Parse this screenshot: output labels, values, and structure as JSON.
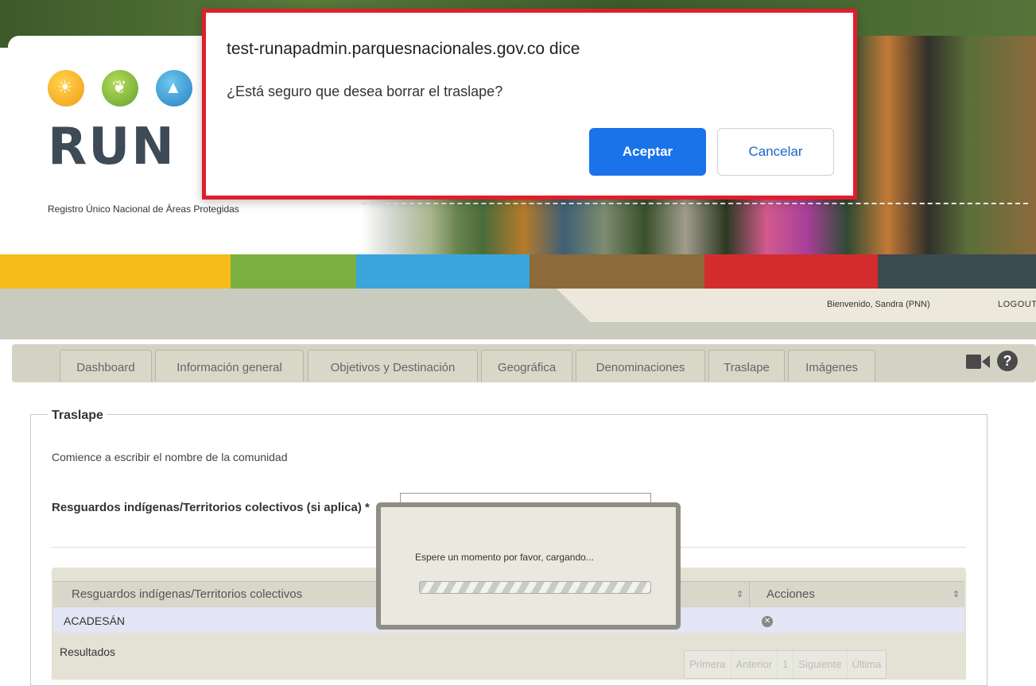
{
  "header": {
    "logo_text": "RUN",
    "subtitle": "Registro Único Nacional de Áreas Protegidas",
    "color_bands": [
      "#f6bd1a",
      "#7ab03f",
      "#3aa6db",
      "#8c6a3c",
      "#d42c2c",
      "#3c4a52"
    ]
  },
  "userbar": {
    "welcome": "Bienvenido, Sandra (PNN)",
    "logout": "LOGOUT"
  },
  "tabs": [
    {
      "label": "Dashboard"
    },
    {
      "label": "Información general"
    },
    {
      "label": "Objetivos y Destinación"
    },
    {
      "label": "Geográfica"
    },
    {
      "label": "Denominaciones"
    },
    {
      "label": "Traslape"
    },
    {
      "label": "Imágenes"
    }
  ],
  "toolbar_icons": [
    "video-camera-icon",
    "help-icon"
  ],
  "section": {
    "legend": "Traslape",
    "hint": "Comience a escribir el nombre de la comunidad",
    "field_label": "Resguardos indígenas/Territorios colectivos (si aplica) *",
    "field_value": ""
  },
  "grid": {
    "columns": [
      "Resguardos indígenas/Territorios colectivos",
      "Acciones"
    ],
    "rows": [
      [
        "ACADESÁN",
        "delete-icon"
      ]
    ],
    "footer_label": "Resultados",
    "pager": [
      "Primera",
      "Anterior",
      "1",
      "Siguiente",
      "Última"
    ]
  },
  "loading": {
    "text": "Espere un momento por favor, cargando..."
  },
  "dialog": {
    "title": "test-runapadmin.parquesnacionales.gov.co dice",
    "message": "¿Está seguro que desea borrar el traslape?",
    "ok_label": "Aceptar",
    "cancel_label": "Cancelar",
    "ok_color": "#1a73e8"
  }
}
